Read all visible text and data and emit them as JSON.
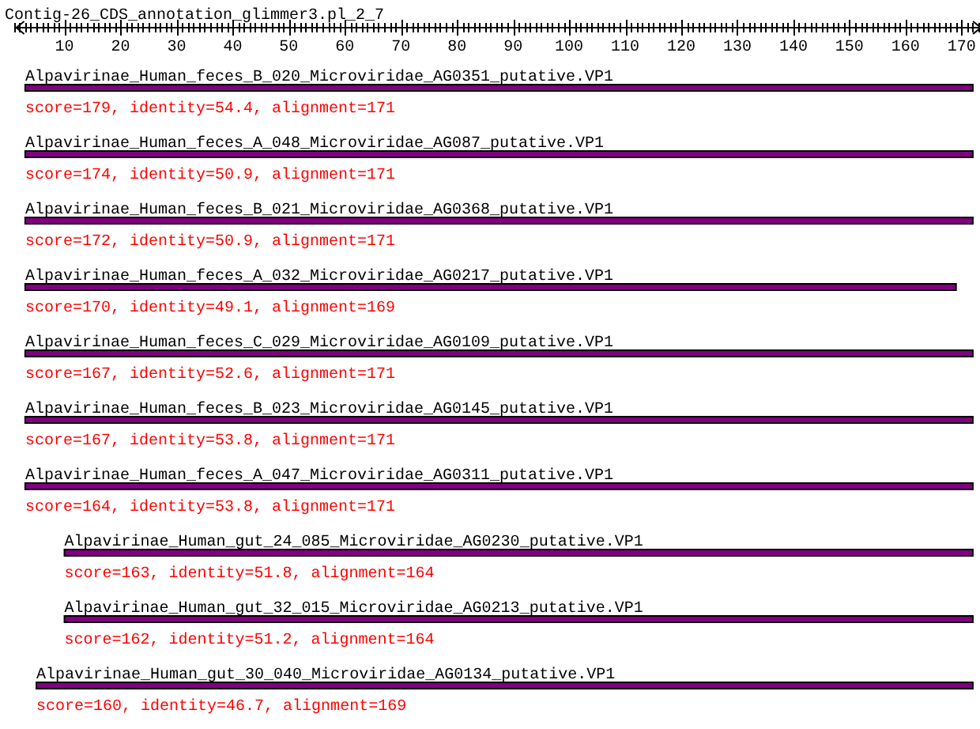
{
  "ruler": {
    "title": "Contig-26_CDS_annotation_glimmer3.pl_2_7",
    "ticks": [
      "10",
      "20",
      "30",
      "40",
      "50",
      "60",
      "70",
      "80",
      "90",
      "100",
      "110",
      "120",
      "130",
      "140",
      "150",
      "160",
      "170"
    ]
  },
  "hits": [
    {
      "name": "Alpavirinae_Human_feces_B_020_Microviridae_AG0351_putative.VP1",
      "score": "score=179, identity=54.4, alignment=171",
      "kind": "flush",
      "level": 0.9885
    },
    {
      "name": "Alpavirinae_Human_feces_A_048_Microviridae_AG087_putative.VP1",
      "score": "score=174, identity=50.9, alignment=171",
      "kind": "flush",
      "level": 0.9885
    },
    {
      "name": "Alpavirinae_Human_feces_B_021_Microviridae_AG0368_putative.VP1",
      "score": "score=172, identity=50.9, alignment=171",
      "kind": "flush",
      "level": 0.9885
    },
    {
      "name": "Alpavirinae_Human_feces_A_032_Microviridae_AG0217_putative.VP1",
      "score": "score=170, identity=49.1, alignment=169",
      "kind": "flush",
      "level": 0.9713
    },
    {
      "name": "Alpavirinae_Human_feces_C_029_Microviridae_AG0109_putative.VP1",
      "score": "score=167, identity=52.6, alignment=171",
      "kind": "flush",
      "level": 0.9885
    },
    {
      "name": "Alpavirinae_Human_feces_B_023_Microviridae_AG0145_putative.VP1",
      "score": "score=167, identity=53.8, alignment=171",
      "kind": "flush",
      "level": 0.9885
    },
    {
      "name": "Alpavirinae_Human_feces_A_047_Microviridae_AG0311_putative.VP1",
      "score": "score=164, identity=53.8, alignment=171",
      "kind": "flush",
      "level": 0.9885
    },
    {
      "name": "Alpavirinae_Human_gut_24_085_Microviridae_AG0230_putative.VP1",
      "score": "score=163, identity=51.8, alignment=164",
      "kind": "inset",
      "level": 0.9885
    },
    {
      "name": "Alpavirinae_Human_gut_32_015_Microviridae_AG0213_putative.VP1",
      "score": "score=162, identity=51.2, alignment=164",
      "kind": "inset",
      "level": 0.9885
    },
    {
      "name": "Alpavirinae_Human_gut_30_040_Microviridae_AG0134_putative.VP1",
      "score": "score=160, identity=46.7, alignment=169",
      "kind": "offset",
      "level": 0.9885
    }
  ]
}
